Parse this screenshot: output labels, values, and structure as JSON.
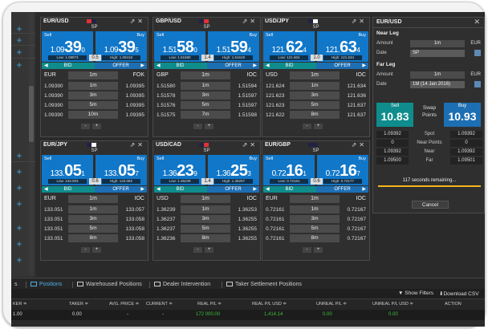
{
  "tiles": [
    {
      "pair": "EUR/USD",
      "tenor": "SP",
      "sell": {
        "label": "Sell",
        "small": "1.09",
        "pip": "39",
        "frac": "0",
        "low": "Low: 1.08973"
      },
      "buy": {
        "label": "Buy",
        "small": "1.09",
        "pip": "39",
        "frac": "5",
        "high": "High: 1.09418"
      },
      "spread": "0.5",
      "bid_label": "BID",
      "offer_label": "OFFER",
      "ccy": "EUR",
      "amount": "1m",
      "mode": "FOK",
      "ladder": [
        {
          "bid": "1.09390",
          "amt": "1m",
          "ask": "1.09395"
        },
        {
          "bid": "1.09390",
          "amt": "3m",
          "ask": "1.09395"
        },
        {
          "bid": "1.09390",
          "amt": "5m",
          "ask": "1.09395"
        },
        {
          "bid": "1.09390",
          "amt": "10m",
          "ask": "1.09395"
        }
      ],
      "minus": "-",
      "plus": "+"
    },
    {
      "pair": "GBP/USD",
      "tenor": "SP",
      "sell": {
        "label": "Sell",
        "small": "1.51",
        "pip": "58",
        "frac": "0",
        "low": "Low: 1.51580"
      },
      "buy": {
        "label": "Buy",
        "small": "1.51",
        "pip": "59",
        "frac": "4",
        "high": "High: 1.51619"
      },
      "spread": "1.4",
      "bid_label": "BID",
      "offer_label": "OFFER",
      "ccy": "GBP",
      "amount": "1m",
      "mode": "IOC",
      "ladder": [
        {
          "bid": "1.51580",
          "amt": "1m",
          "ask": "1.51594"
        },
        {
          "bid": "1.51578",
          "amt": "3m",
          "ask": "1.51597"
        },
        {
          "bid": "1.51576",
          "amt": "5m",
          "ask": "1.51597"
        },
        {
          "bid": "1.51575",
          "amt": "7m",
          "ask": "1.51598"
        }
      ],
      "minus": "-",
      "plus": "+"
    },
    {
      "pair": "USD/JPY",
      "tenor": "SP",
      "sell": {
        "label": "Sell",
        "small": "121.",
        "pip": "62",
        "frac": "4",
        "low": "Low: 121.604"
      },
      "buy": {
        "label": "Buy",
        "small": "121.",
        "pip": "63",
        "frac": "4",
        "high": "High: 121.634"
      },
      "spread": "1.0",
      "bid_label": "BID",
      "offer_label": "OFFER",
      "ccy": "USD",
      "amount": "1m",
      "mode": "IOC",
      "ladder": [
        {
          "bid": "121.624",
          "amt": "1m",
          "ask": "121.634"
        },
        {
          "bid": "121.623",
          "amt": "3m",
          "ask": "121.636"
        },
        {
          "bid": "121.623",
          "amt": "5m",
          "ask": "121.637"
        },
        {
          "bid": "121.622",
          "amt": "8m",
          "ask": "121.637"
        }
      ],
      "minus": "-",
      "plus": "+"
    },
    {
      "pair": "EUR/JPY",
      "tenor": "SP",
      "sell": {
        "label": "Sell",
        "small": "133.",
        "pip": "05",
        "frac": "1",
        "low": "Low: 133.003"
      },
      "buy": {
        "label": "Buy",
        "small": "133.",
        "pip": "05",
        "frac": "7",
        "high": "High: 133.082"
      },
      "spread": "0.6",
      "bid_label": "BID",
      "offer_label": "OFFER",
      "ccy": "EUR",
      "amount": "1m",
      "mode": "IOC",
      "ladder": [
        {
          "bid": "133.051",
          "amt": "1m",
          "ask": "133.057"
        },
        {
          "bid": "133.051",
          "amt": "3m",
          "ask": "133.058"
        },
        {
          "bid": "133.051",
          "amt": "5m",
          "ask": "133.058"
        },
        {
          "bid": "133.051",
          "amt": "8m",
          "ask": "133.058"
        }
      ],
      "minus": "-",
      "plus": "+"
    },
    {
      "pair": "USD/CAD",
      "tenor": "SP",
      "sell": {
        "label": "Sell",
        "small": "1.36",
        "pip": "23",
        "frac": "9",
        "low": "Low: 1.36239"
      },
      "buy": {
        "label": "Buy",
        "small": "1.36",
        "pip": "25",
        "frac": "3",
        "high": "High: 1.36257"
      },
      "spread": "1.4",
      "bid_label": "BID",
      "offer_label": "OFFER",
      "ccy": "USD",
      "amount": "1m",
      "mode": "IOC",
      "ladder": [
        {
          "bid": "1.36239",
          "amt": "1m",
          "ask": "1.36253"
        },
        {
          "bid": "1.36237",
          "amt": "3m",
          "ask": "1.36255"
        },
        {
          "bid": "1.36237",
          "amt": "5m",
          "ask": "1.36255"
        },
        {
          "bid": "1.36236",
          "amt": "8m",
          "ask": "1.36255"
        }
      ],
      "minus": "-",
      "plus": "+"
    },
    {
      "pair": "EUR/GBP",
      "tenor": "SP",
      "sell": {
        "label": "Sell",
        "small": "0.72",
        "pip": "16",
        "frac": "1",
        "low": "Low: 0.72161"
      },
      "buy": {
        "label": "Buy",
        "small": "0.72",
        "pip": "16",
        "frac": "7",
        "high": "High: 0.72177"
      },
      "spread": "0.6",
      "bid_label": "BID",
      "offer_label": "OFFER",
      "ccy": "EUR",
      "amount": "1m",
      "mode": "IOC",
      "ladder": [
        {
          "bid": "0.72161",
          "amt": "1m",
          "ask": "0.72167"
        },
        {
          "bid": "0.72161",
          "amt": "3m",
          "ask": "0.72167"
        },
        {
          "bid": "0.72161",
          "amt": "5m",
          "ask": "0.72167"
        },
        {
          "bid": "0.72161",
          "amt": "8m",
          "ask": "0.72167"
        }
      ],
      "minus": "-",
      "plus": "+"
    }
  ],
  "panel": {
    "title": "EUR/USD",
    "near_leg": "Near Leg",
    "amount_label": "Amount",
    "near_amount": "1m",
    "near_ccy": "EUR",
    "date_label": "Date",
    "near_date": "SP",
    "far_leg": "Far Leg",
    "far_amount": "1m",
    "far_ccy": "EUR",
    "far_date": "1M (14 Jan 2016)",
    "sell_label": "Sell",
    "sell_value": "10.83",
    "swap_label": "Swap Points",
    "buy_label": "Buy",
    "buy_value": "10.93",
    "rows": [
      {
        "l": "1.09392",
        "m": "Spot",
        "r": "1.09392"
      },
      {
        "l": "0",
        "m": "Near Points",
        "r": "0"
      },
      {
        "l": "1.09392",
        "m": "Near",
        "r": "1.09392"
      },
      {
        "l": "1.09500",
        "m": "Far",
        "r": "1.09501"
      }
    ],
    "remaining": "117 seconds remaining...",
    "cancel": "Cancel"
  },
  "bottom": {
    "tabs": [
      "s",
      "Positions",
      "Warehoused Positions",
      "Dealer Intervention",
      "Taker Settlement Positions"
    ],
    "show_filters": "Show Filters",
    "download_csv": "Download CSV",
    "headers": [
      "KER ≑",
      "TAKER ≑",
      "AVG. PRICE ≑",
      "CURRENT ≑",
      "REAL P/L ≑",
      "REAL P/L USD ≑",
      "UNREAL P/L ≑",
      "UNREAL P/L USD ≑",
      "ACTION"
    ],
    "row": [
      "1.00",
      "0.00",
      "-",
      "-",
      "172 000.00",
      "1,414.14",
      "0.00",
      "0.00"
    ]
  },
  "colors": {
    "sell_blue": "#1177c8",
    "bid_teal": "#0f8c8c",
    "timer_bar": "#f2b51b",
    "positive_green": "#3bbf3b"
  }
}
